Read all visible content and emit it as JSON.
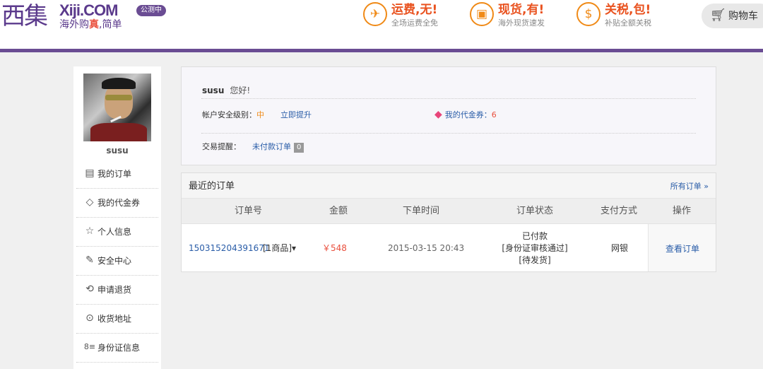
{
  "header": {
    "logo_mark": "西集",
    "brand": "Xiji.COM",
    "slogan_prefix": "海外购",
    "slogan_highlight": "真",
    "slogan_suffix": ",简单",
    "beta": "公测中",
    "promos": [
      {
        "icon": "✈",
        "title": "运费,无!",
        "sub": "全场运费全免"
      },
      {
        "icon": "▣",
        "title": "现货,有!",
        "sub": "海外现货速发"
      },
      {
        "icon": "$",
        "title": "关税,包!",
        "sub": "补贴全额关税"
      }
    ],
    "cart_label": "购物车"
  },
  "sidebar": {
    "username": "susu",
    "items": [
      {
        "icon": "▤",
        "label": "我的订单"
      },
      {
        "icon": "◇",
        "label": "我的代金券"
      },
      {
        "icon": "☆",
        "label": "个人信息"
      },
      {
        "icon": "✎",
        "label": "安全中心"
      },
      {
        "icon": "⟲",
        "label": "申请退货"
      },
      {
        "icon": "⊙",
        "label": "收货地址"
      },
      {
        "icon": "8≡",
        "label": "身份证信息"
      }
    ]
  },
  "account": {
    "username": "susu",
    "greeting": "您好!",
    "security_label": "帐户安全级别：",
    "security_level": "中",
    "upgrade_link": "立即提升",
    "voucher_label": "我的代金券：",
    "voucher_count": "6",
    "reminder_label": "交易提醒：",
    "unpaid_link": "未付款订单",
    "unpaid_count": "0"
  },
  "orders": {
    "title": "最近的订单",
    "all_link": "所有订单 »",
    "columns": [
      "订单号",
      "金额",
      "下单时间",
      "订单状态",
      "支付方式",
      "操作"
    ],
    "rows": [
      {
        "order_no": "150315204391671",
        "items": "[1商品]▾",
        "amount": "￥548",
        "time": "2015-03-15 20:43",
        "status_1": "已付款",
        "status_2": "[身份证审核通过]",
        "status_3": "[待发货]",
        "payment": "网银",
        "action": "查看订单"
      }
    ]
  },
  "colors": {
    "brand_purple": "#6a4c93",
    "promo_orange": "#f08a17",
    "price_red": "#e94e3c",
    "link_blue": "#2a5da8"
  }
}
